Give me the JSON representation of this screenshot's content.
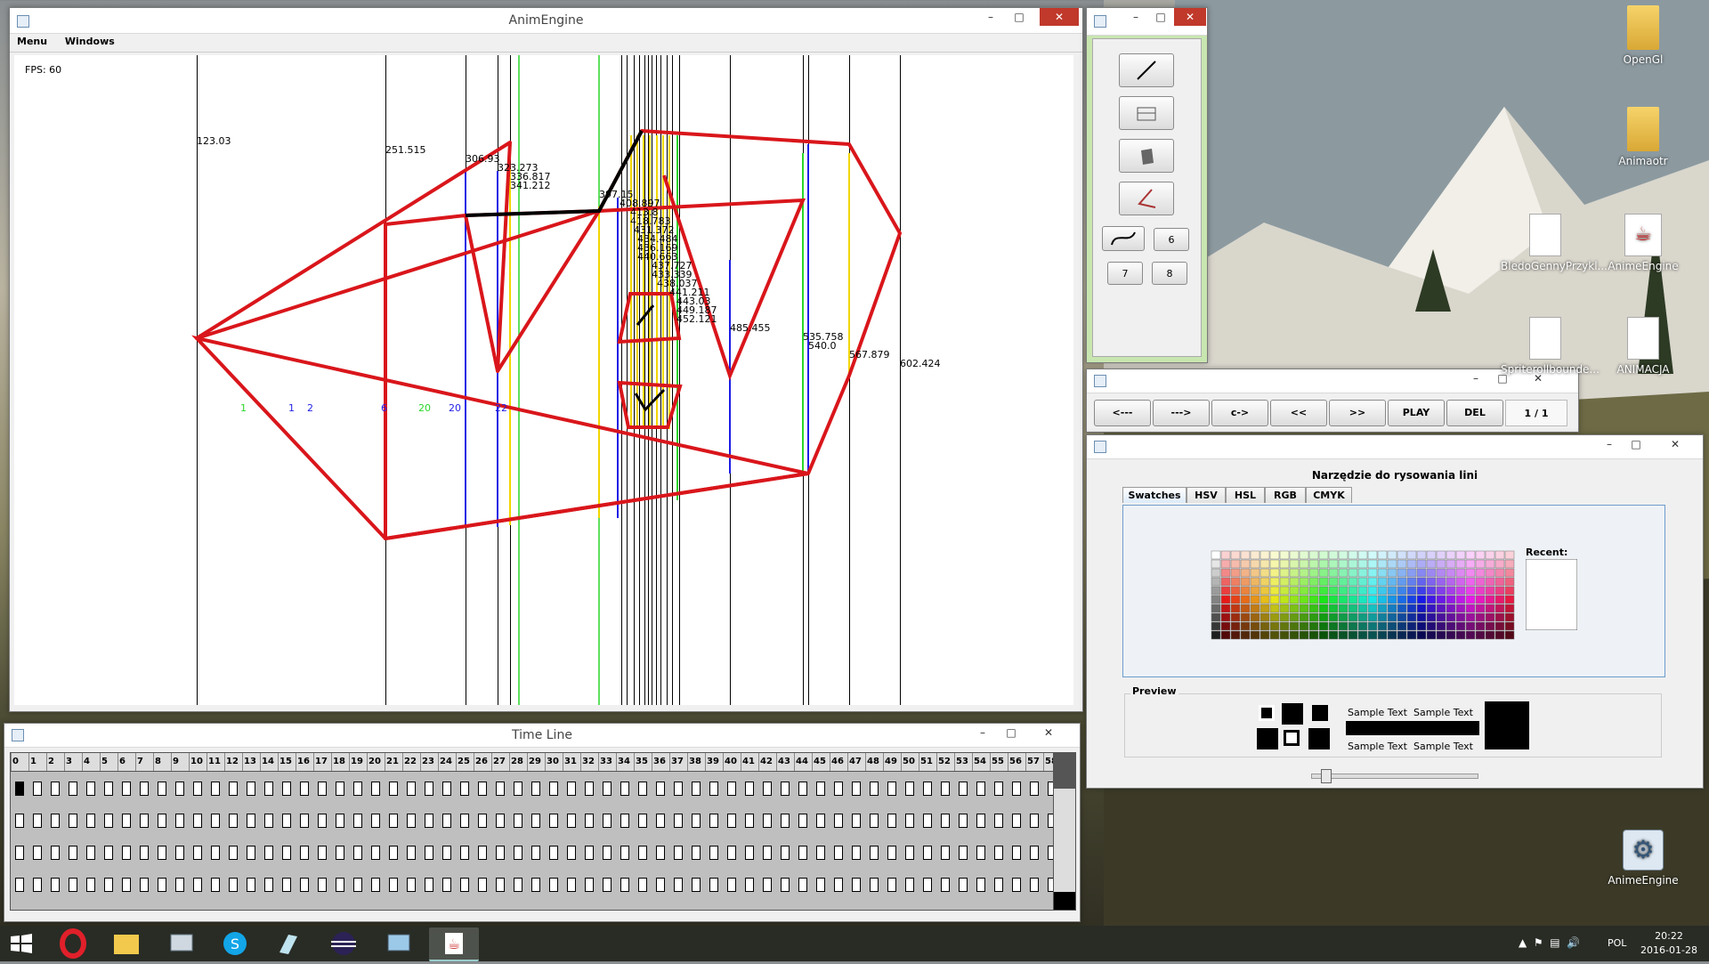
{
  "main_window": {
    "title": "AnimEngine",
    "menu": [
      "Menu",
      "Windows"
    ],
    "fps": "FPS: 60",
    "top_labels": [
      "123.03",
      "251.515",
      "306.93",
      "323.273",
      "336.817",
      "341.212",
      "397.15",
      "408.897",
      "413.8",
      "418.783",
      "431.372",
      "434.484",
      "436.169",
      "440.663",
      "437.727",
      "433.339",
      "438.037",
      "441.211",
      "443.03",
      "449.187",
      "452.121",
      "485.455",
      "535.758",
      "540.0",
      "567.879",
      "602.424"
    ],
    "frame_labels": [
      "1",
      "1",
      "2",
      "6",
      "20",
      "20",
      "22"
    ]
  },
  "tools_window": {
    "buttons_small": [
      "6",
      "7",
      "8"
    ]
  },
  "nav_window": {
    "buttons": [
      "<---",
      "--->",
      "c->",
      "<<",
      ">>",
      "PLAY",
      "DEL"
    ],
    "page": "1 / 1"
  },
  "color_window": {
    "title": "Narzędzie do rysowania lini",
    "tabs": [
      "Swatches",
      "HSV",
      "HSL",
      "RGB",
      "CMYK"
    ],
    "recent_label": "Recent:",
    "preview_label": "Preview",
    "sample_text": "Sample Text  Sample Text"
  },
  "timeline_window": {
    "title": "Time Line",
    "frames": [
      "0",
      "1",
      "2",
      "3",
      "4",
      "5",
      "6",
      "7",
      "8",
      "9",
      "10",
      "11",
      "12",
      "13",
      "14",
      "15",
      "16",
      "17",
      "18",
      "19",
      "20",
      "21",
      "22",
      "23",
      "24",
      "25",
      "26",
      "27",
      "28",
      "29",
      "30",
      "31",
      "32",
      "33",
      "34",
      "35",
      "36",
      "37",
      "38",
      "39",
      "40",
      "41",
      "42",
      "43",
      "44",
      "45",
      "46",
      "47",
      "48",
      "49",
      "50",
      "51",
      "52",
      "53",
      "54",
      "55",
      "56",
      "57",
      "58"
    ]
  },
  "desktop_icons": [
    "OpenGl",
    "Animaotr",
    "BledoGennyPrzykl...",
    "AnimeEngine",
    "Spriterollbounde...",
    "ANIMACJA",
    "AnimeEngine"
  ],
  "taskbar": {
    "lang": "POL",
    "time": "20:22",
    "date": "2016-01-28"
  },
  "colors": {
    "red": "#d9161b",
    "blue": "#1e1ee6",
    "green": "#2ad62a",
    "yellow": "#f2d600",
    "close": "#c0392b"
  }
}
